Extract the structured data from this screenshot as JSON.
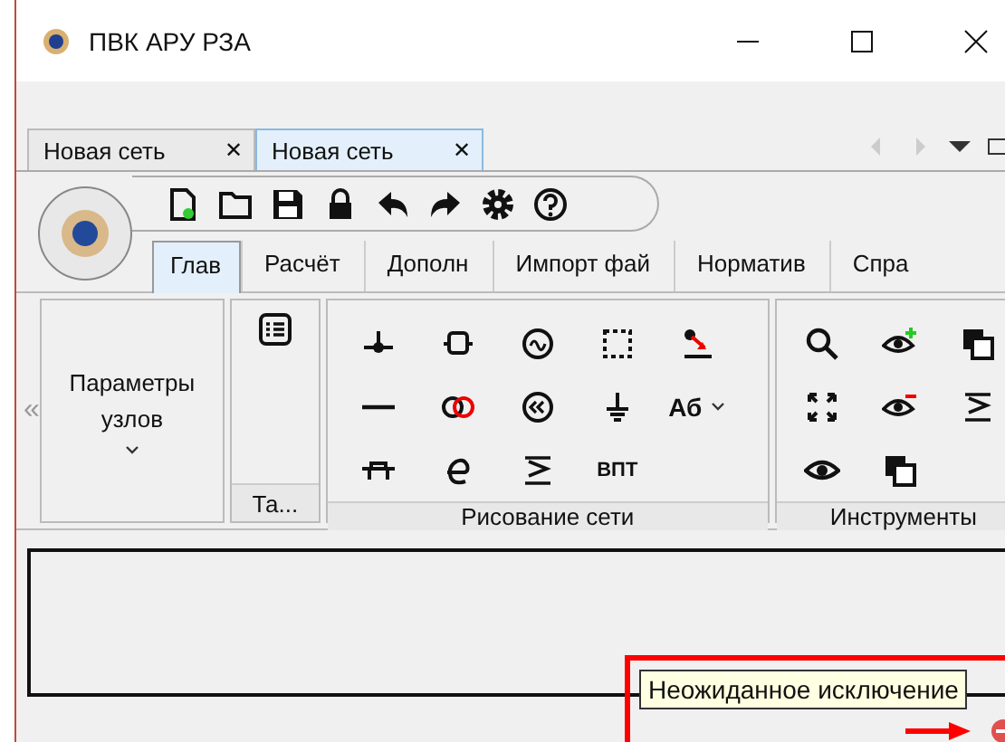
{
  "window": {
    "title": "ПВК АРУ РЗА"
  },
  "document_tabs": [
    {
      "label": "Новая сеть",
      "close": "✕",
      "selected": false
    },
    {
      "label": "Новая сеть",
      "close": "✕",
      "selected": true
    }
  ],
  "ribbon_tabs": [
    {
      "label": "Глав",
      "selected": true
    },
    {
      "label": "Расчёт",
      "selected": false
    },
    {
      "label": "Дополн",
      "selected": false
    },
    {
      "label": "Импорт фай",
      "selected": false
    },
    {
      "label": "Норматив",
      "selected": false
    },
    {
      "label": "Спра",
      "selected": false
    }
  ],
  "collapse": "«",
  "node_params": {
    "button": "Параметры узлов"
  },
  "tables_group": {
    "label": "Та..."
  },
  "drawing_group": {
    "label": "Рисование сети",
    "text_tools": [
      "Аб",
      "ВПТ"
    ]
  },
  "tools_group": {
    "label": "Инструменты"
  },
  "error_tooltip": {
    "text": "Неожиданное исключение"
  }
}
